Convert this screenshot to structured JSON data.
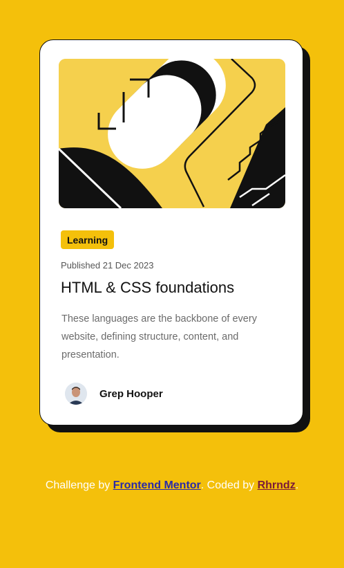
{
  "card": {
    "tag": "Learning",
    "published": "Published 21 Dec 2023",
    "title": "HTML & CSS foundations",
    "description": "These languages are the backbone of every website, defining structure, content, and presentation.",
    "author": "Grep Hooper"
  },
  "footer": {
    "prefix": "Challenge by ",
    "link1": "Frontend Mentor",
    "middle": ". Coded by ",
    "link2": "Rhrndz",
    "suffix": "."
  },
  "colors": {
    "background": "#f4c00b",
    "card": "#ffffff",
    "ink": "#111111"
  }
}
